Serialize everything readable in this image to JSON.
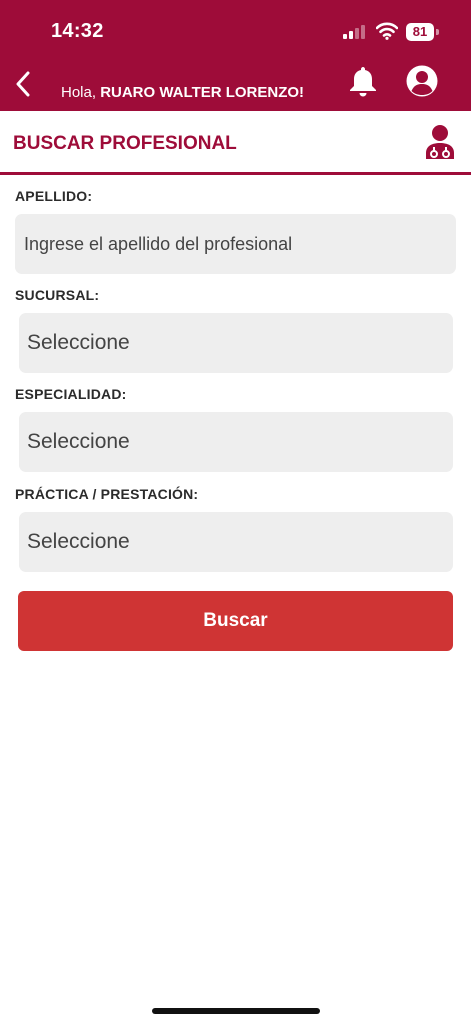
{
  "status_bar": {
    "time": "14:32",
    "battery": "81"
  },
  "header": {
    "greeting_prefix": "Hola, ",
    "user_name": "RUARO WALTER LORENZO!",
    "icons": [
      "chevron-left-icon",
      "bell-icon",
      "user-circle-icon"
    ]
  },
  "section": {
    "title": "BUSCAR PROFESIONAL",
    "icon": "doctor-icon"
  },
  "form": {
    "apellido_label": "APELLIDO:",
    "apellido_placeholder": "Ingrese el apellido del profesional",
    "sucursal_label": "SUCURSAL:",
    "sucursal_value": "Seleccione",
    "especialidad_label": "ESPECIALIDAD:",
    "especialidad_value": "Seleccione",
    "practica_label": "PRÁCTICA / PRESTACIÓN:",
    "practica_value": "Seleccione",
    "submit_label": "Buscar"
  },
  "colors": {
    "brand": "#9e0c39",
    "button": "#cf3434",
    "field_bg": "#eeeeee"
  }
}
